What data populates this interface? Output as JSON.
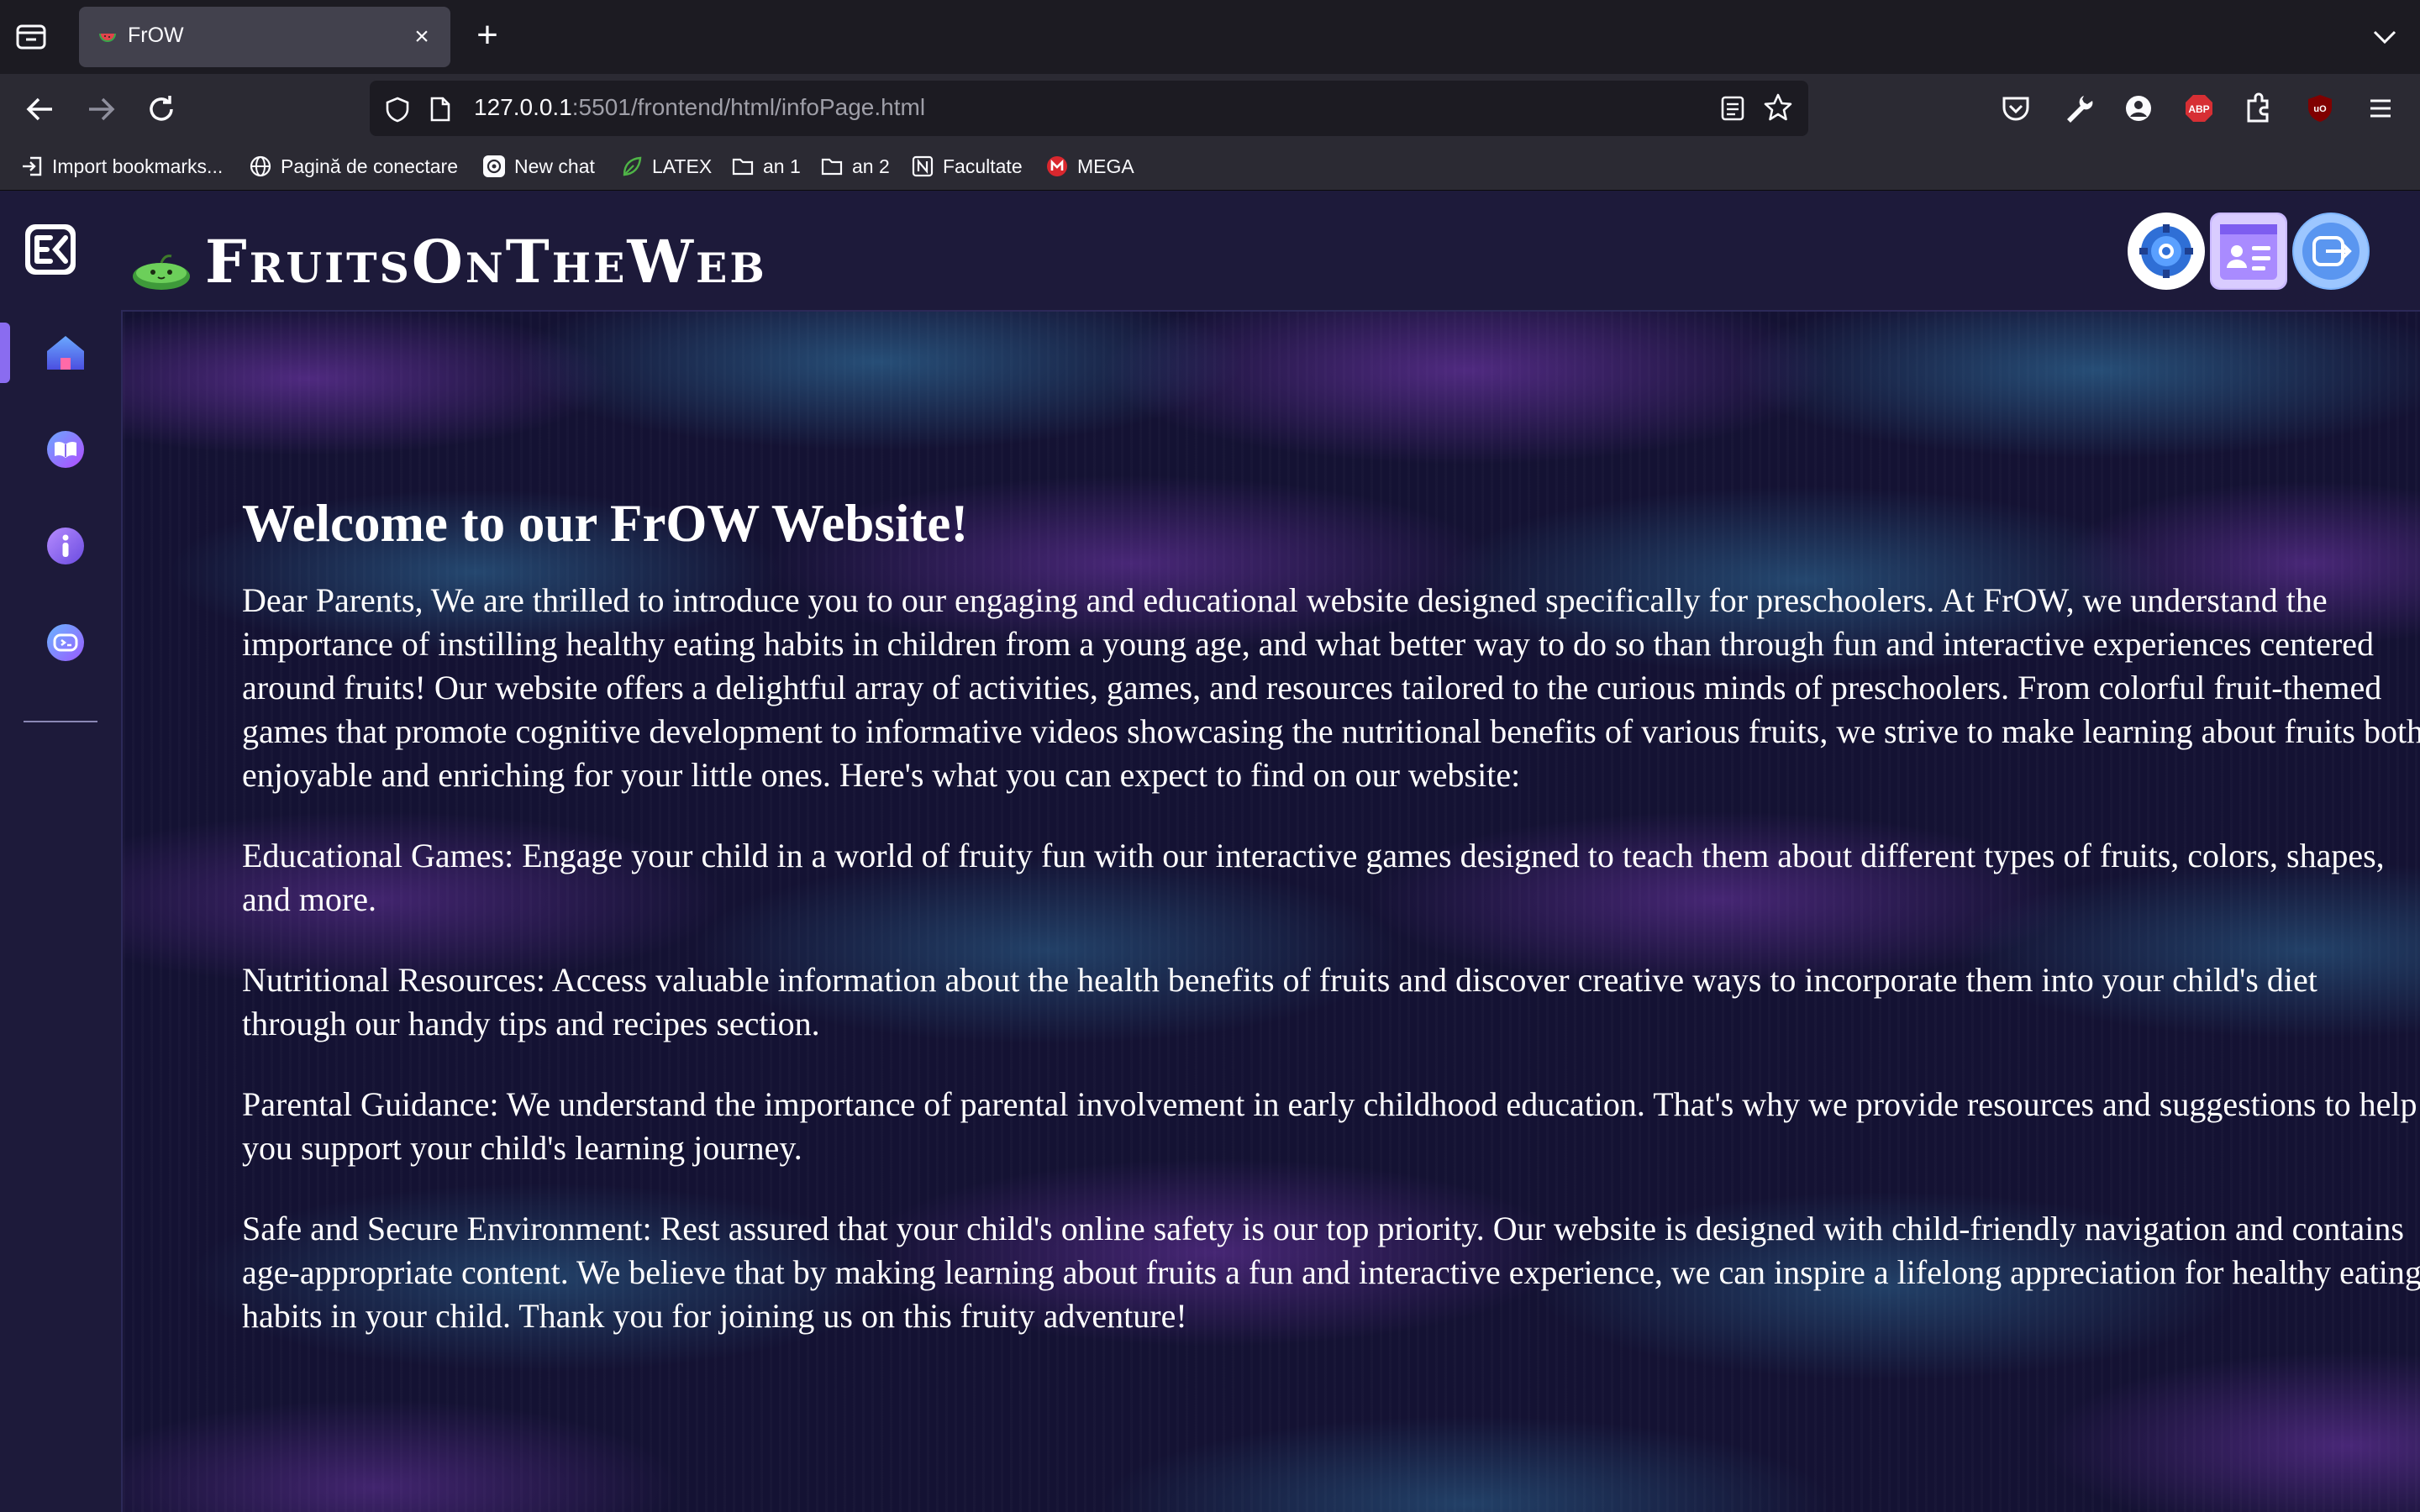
{
  "browser": {
    "tab_title": "FrOW",
    "url_host": "127.0.0.1",
    "url_rest": ":5501/frontend/html/infoPage.html",
    "bookmarks": [
      {
        "label": "Import bookmarks...",
        "icon": "import-icon"
      },
      {
        "label": "Pagină de conectare",
        "icon": "globe-icon"
      },
      {
        "label": "New chat",
        "icon": "openai-icon"
      },
      {
        "label": "LATEX",
        "icon": "leaf-icon"
      },
      {
        "label": "an 1",
        "icon": "folder-icon"
      },
      {
        "label": "an 2",
        "icon": "folder-icon"
      },
      {
        "label": "Facultate",
        "icon": "notion-icon"
      },
      {
        "label": "MEGA",
        "icon": "mega-icon"
      }
    ],
    "toolbar_icons": [
      "pocket-icon",
      "wrench-icon",
      "account-icon",
      "adblock-icon",
      "extensions-icon",
      "ublock-icon",
      "menu-icon"
    ]
  },
  "app": {
    "brand": "FruitsOnTheWeb",
    "sidebar_items": [
      "home-icon",
      "book-icon",
      "info-icon",
      "game-icon"
    ],
    "header_buttons": [
      "settings-button",
      "profile-button",
      "logout-button"
    ],
    "accent_color": "#8a6cf0"
  },
  "article": {
    "heading": "Welcome to our FrOW Website!",
    "paragraphs": [
      "Dear Parents, We are thrilled to introduce you to our engaging and educational website designed specifically for preschoolers. At FrOW, we understand the importance of instilling healthy eating habits in children from a young age, and what better way to do so than through fun and interactive experiences centered around fruits! Our website offers a delightful array of activities, games, and resources tailored to the curious minds of preschoolers. From colorful fruit-themed games that promote cognitive development to informative videos showcasing the nutritional benefits of various fruits, we strive to make learning about fruits both enjoyable and enriching for your little ones. Here's what you can expect to find on our website:",
      "Educational Games: Engage your child in a world of fruity fun with our interactive games designed to teach them about different types of fruits, colors, shapes, and more.",
      "Nutritional Resources: Access valuable information about the health benefits of fruits and discover creative ways to incorporate them into your child's diet through our handy tips and recipes section.",
      "Parental Guidance: We understand the importance of parental involvement in early childhood education. That's why we provide resources and suggestions to help you support your child's learning journey.",
      "Safe and Secure Environment: Rest assured that your child's online safety is our top priority. Our website is designed with child-friendly navigation and contains age-appropriate content. We believe that by making learning about fruits a fun and interactive experience, we can inspire a lifelong appreciation for healthy eating habits in your child. Thank you for joining us on this fruity adventure!"
    ]
  }
}
